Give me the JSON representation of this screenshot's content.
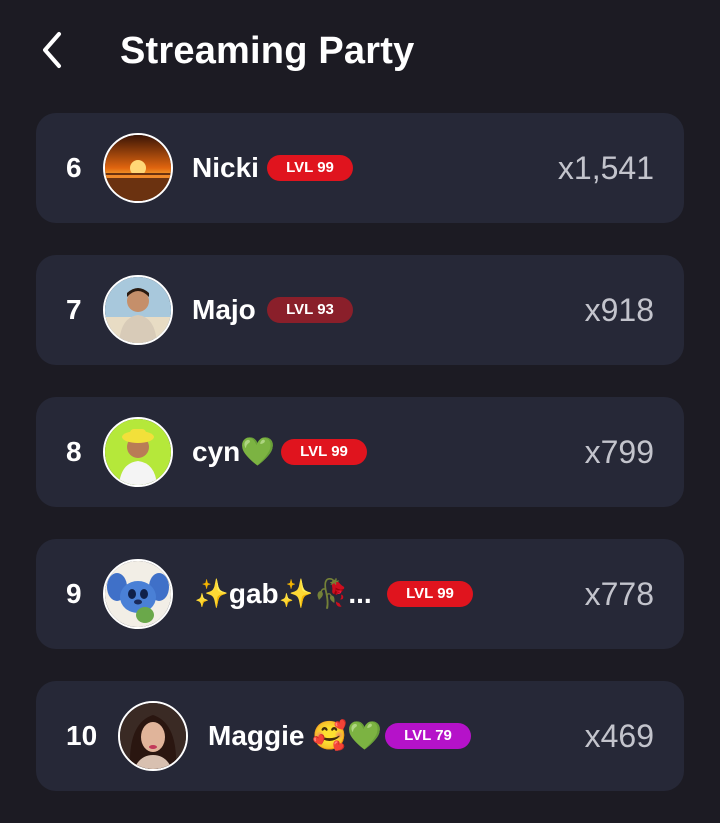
{
  "header": {
    "title": "Streaming Party",
    "back_icon": "chevron-left-icon"
  },
  "rows": [
    {
      "rank": "6",
      "name": "Nicki",
      "level": "LVL 99",
      "level_color": "#e0141e",
      "count": "x1,541",
      "avatar": "sunset-photo"
    },
    {
      "rank": "7",
      "name": "Majo",
      "level": "LVL 93",
      "level_color": "#8a1f2a",
      "count": "x918",
      "avatar": "man-beach-photo"
    },
    {
      "rank": "8",
      "name": "cyn💚",
      "level": "LVL 99",
      "level_color": "#e0141e",
      "count": "x799",
      "avatar": "man-yellow-hat-photo"
    },
    {
      "rank": "9",
      "name": "✨gab✨🥀...",
      "level": "LVL 99",
      "level_color": "#e0141e",
      "count": "x778",
      "avatar": "stitch-cartoon"
    },
    {
      "rank": "10",
      "name": "Maggie 🥰💚",
      "level": "LVL 79",
      "level_color": "#b512c9",
      "count": "x469",
      "avatar": "woman-selfie-photo"
    }
  ]
}
